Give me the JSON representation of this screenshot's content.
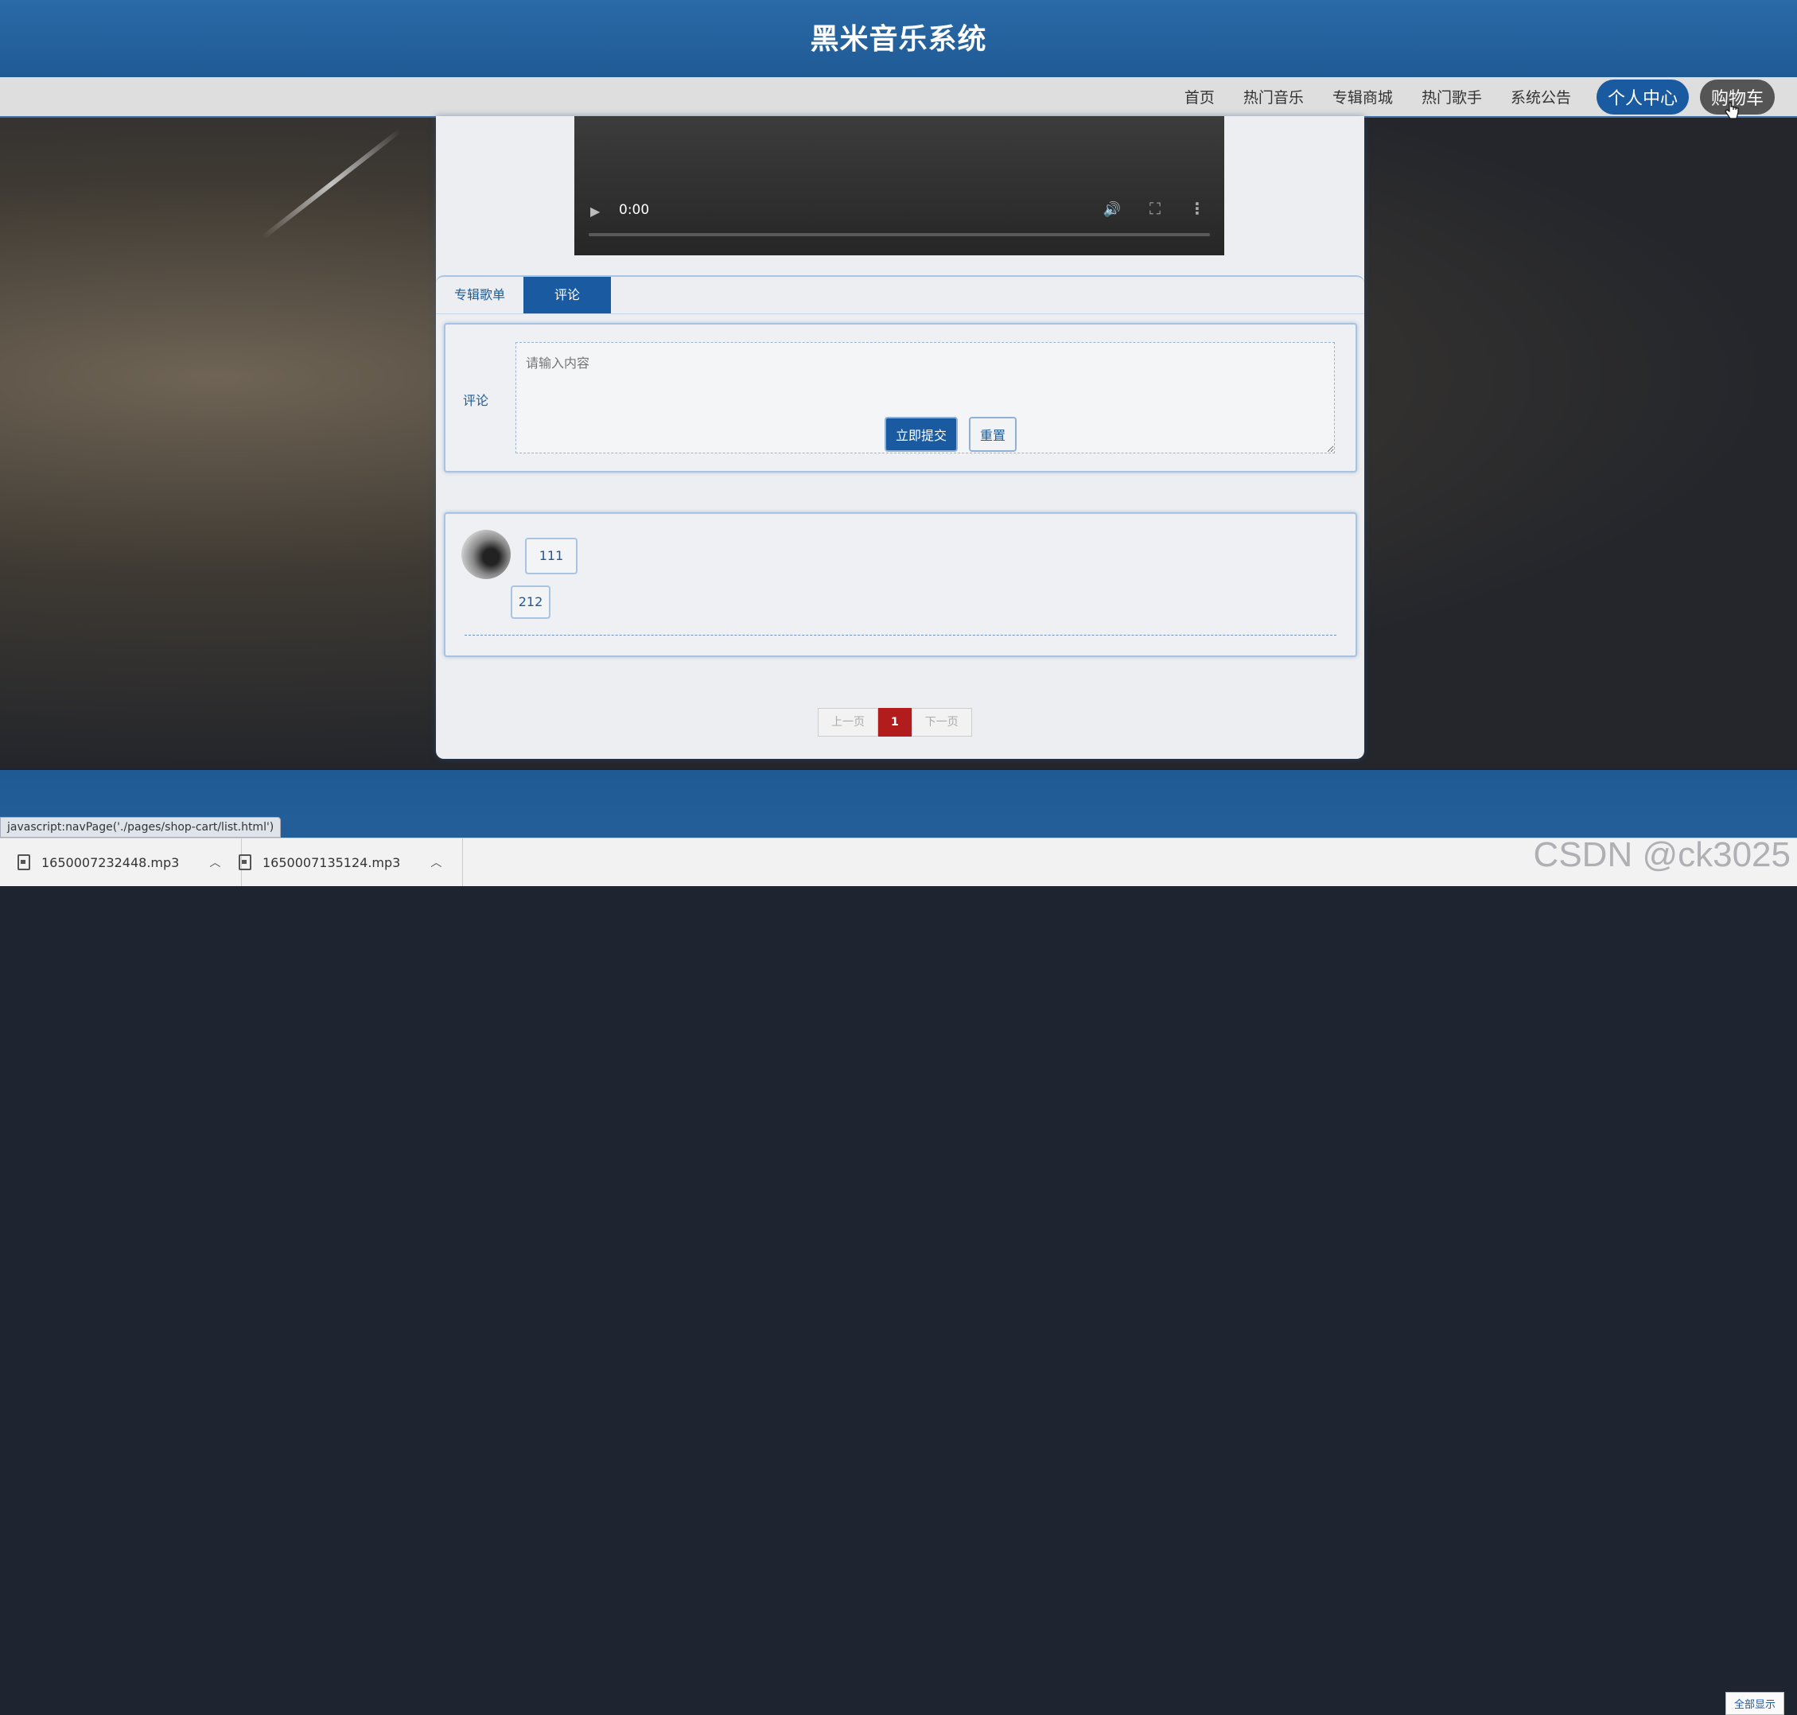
{
  "header": {
    "title": "黑米音乐系统"
  },
  "nav": {
    "items": [
      "首页",
      "热门音乐",
      "专辑商城",
      "热门歌手",
      "系统公告"
    ],
    "personal_center": "个人中心",
    "cart": "购物车"
  },
  "player": {
    "time": "0:00"
  },
  "tabs": [
    {
      "label": "专辑歌单",
      "active": false
    },
    {
      "label": "评论",
      "active": true
    }
  ],
  "comment_form": {
    "label": "评论",
    "placeholder": "请输入内容",
    "submit_label": "立即提交",
    "reset_label": "重置"
  },
  "comments": [
    {
      "user": "111",
      "text": "212"
    }
  ],
  "pagination": {
    "prev": "上一页",
    "current": "1",
    "next": "下一页"
  },
  "status_bar": {
    "url": "javascript:navPage('./pages/shop-cart/list.html')"
  },
  "downloads": [
    {
      "file": "1650007232448.mp3"
    },
    {
      "file": "1650007135124.mp3"
    }
  ],
  "download_bar": {
    "show_all": "全部显示"
  },
  "watermark": "CSDN @ck3025",
  "colors": {
    "primary": "#1a5aa0",
    "pager_active": "#b31c1c",
    "cart_pill": "#555555"
  }
}
